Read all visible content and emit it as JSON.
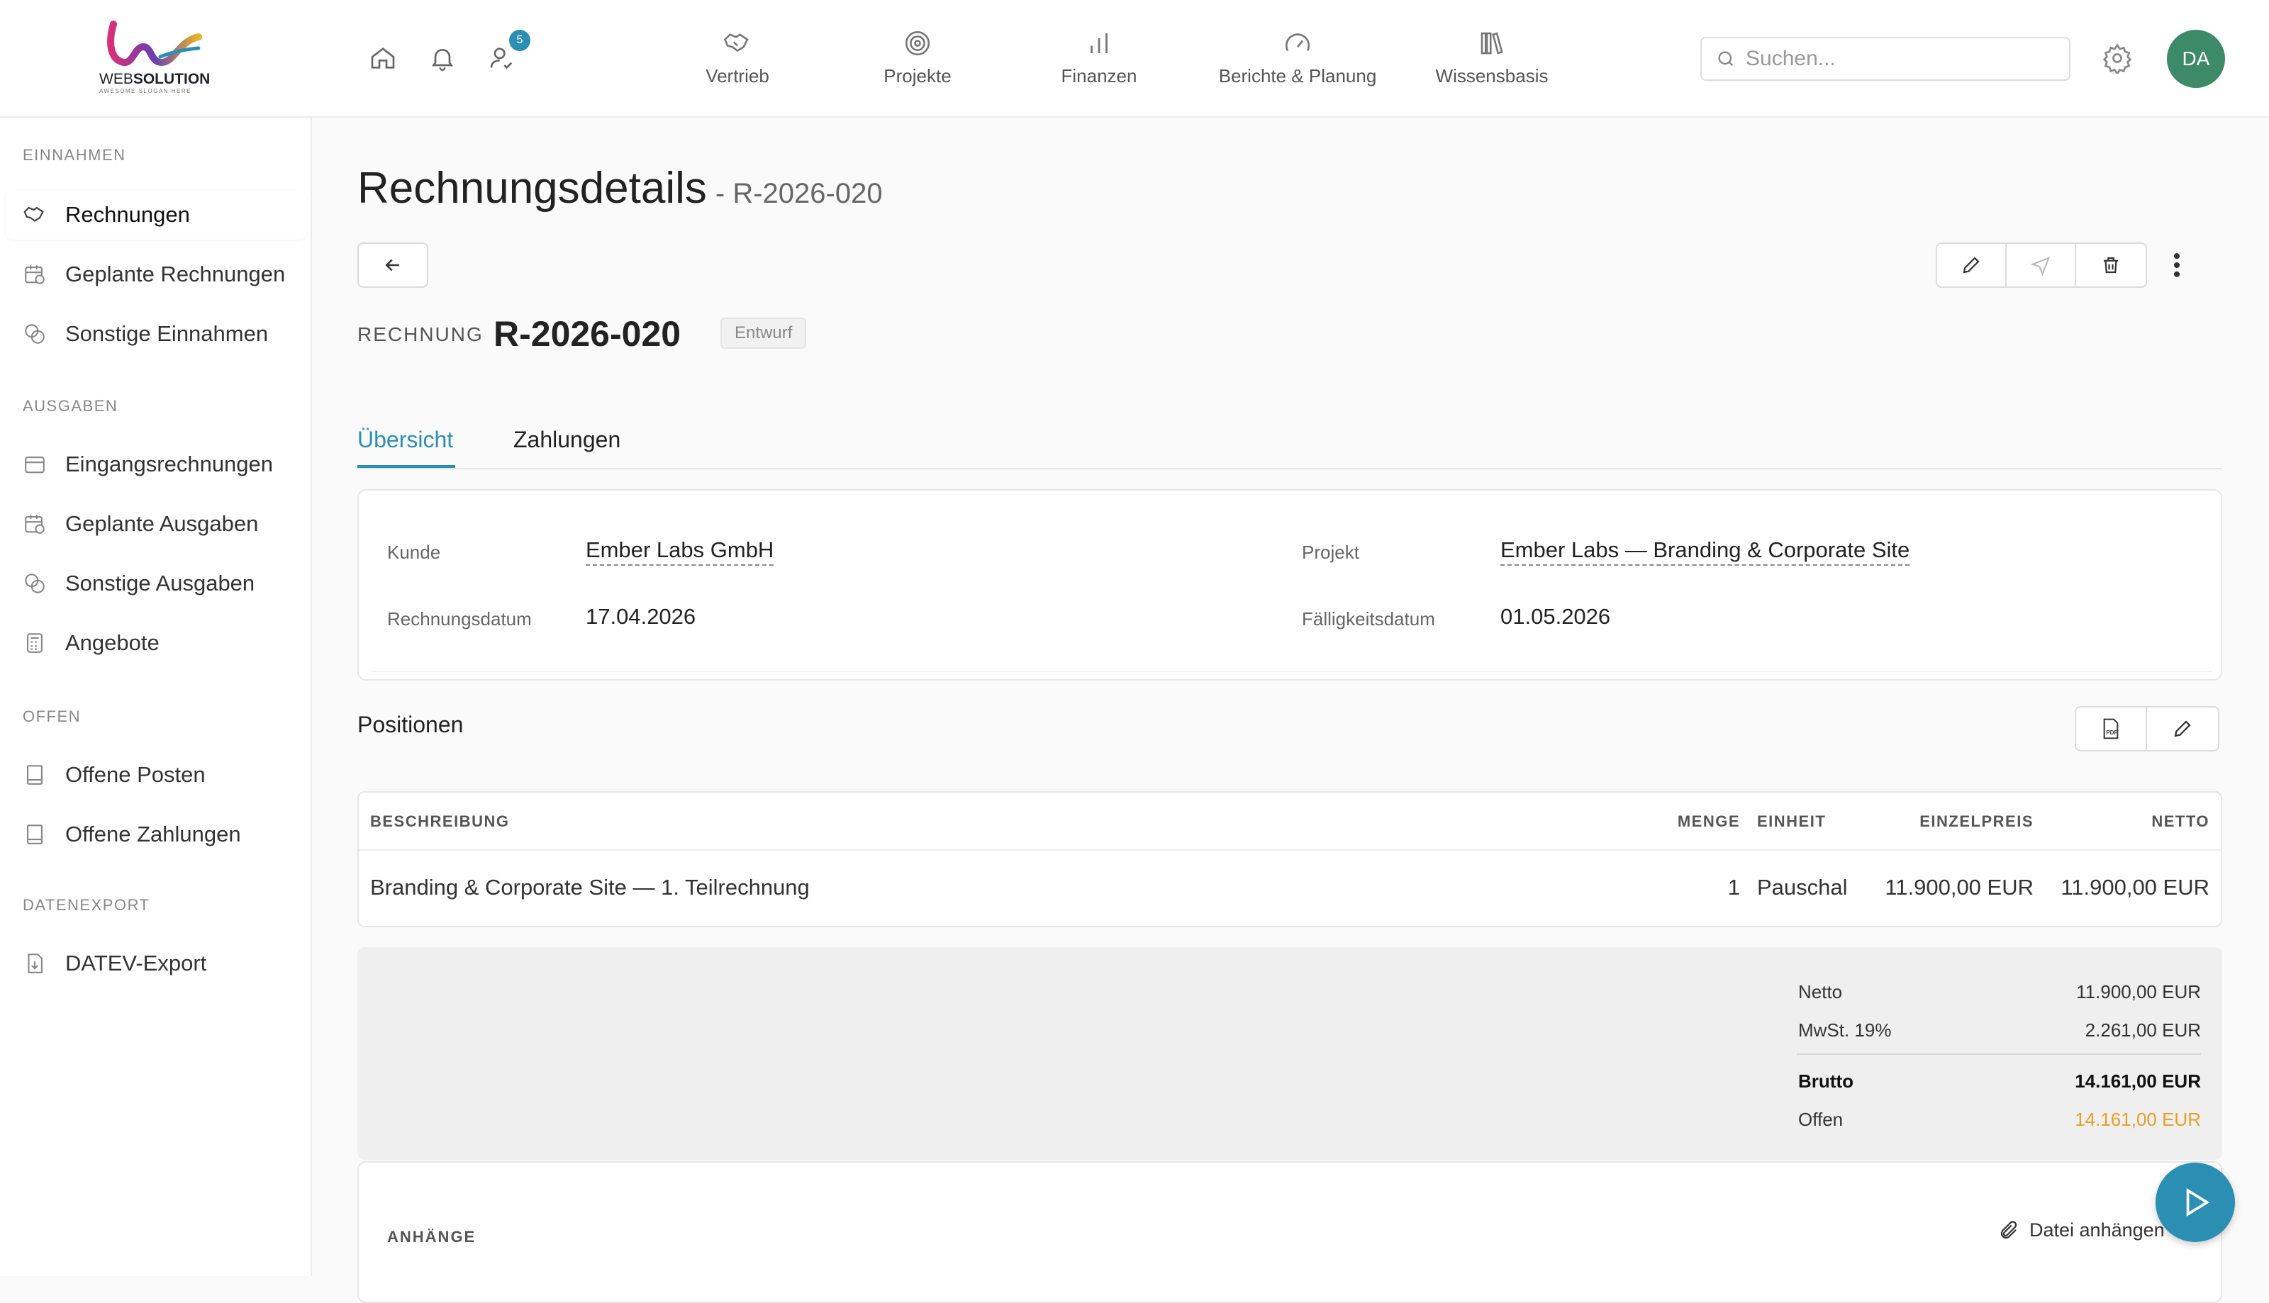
{
  "brand": {
    "name_a": "WEB",
    "name_b": "SOLUTION",
    "tagline": "AWESOME SLOGAN HERE"
  },
  "header": {
    "notification_badge": "5",
    "nav": [
      {
        "label": "Vertrieb",
        "icon": "handshake-icon"
      },
      {
        "label": "Projekte",
        "icon": "target-icon"
      },
      {
        "label": "Finanzen",
        "icon": "bar-chart-icon"
      },
      {
        "label": "Berichte & Planung",
        "icon": "gauge-icon"
      },
      {
        "label": "Wissensbasis",
        "icon": "books-icon"
      }
    ],
    "search_placeholder": "Suchen...",
    "avatar_initials": "DA"
  },
  "sidebar": {
    "sections": [
      {
        "title": "EINNAHMEN",
        "items": [
          {
            "label": "Rechnungen",
            "active": true
          },
          {
            "label": "Geplante Rechnungen"
          },
          {
            "label": "Sonstige Einnahmen"
          }
        ]
      },
      {
        "title": "AUSGABEN",
        "items": [
          {
            "label": "Eingangsrechnungen"
          },
          {
            "label": "Geplante Ausgaben"
          },
          {
            "label": "Sonstige Ausgaben"
          },
          {
            "label": "Angebote"
          }
        ]
      },
      {
        "title": "OFFEN",
        "items": [
          {
            "label": "Offene Posten"
          },
          {
            "label": "Offene Zahlungen"
          }
        ]
      },
      {
        "title": "DATENEXPORT",
        "items": [
          {
            "label": "DATEV-Export"
          }
        ]
      }
    ]
  },
  "page": {
    "title": "Rechnungsdetails",
    "subtitle": "- R-2026-020",
    "invoice_label": "RECHNUNG",
    "invoice_number": "R-2026-020",
    "status": "Entwurf",
    "tabs": [
      "Übersicht",
      "Zahlungen"
    ],
    "details": {
      "kunde_label": "Kunde",
      "kunde": "Ember Labs GmbH",
      "projekt_label": "Projekt",
      "projekt": "Ember Labs — Branding & Corporate Site",
      "datum_label": "Rechnungsdatum",
      "datum": "17.04.2026",
      "faellig_label": "Fälligkeitsdatum",
      "faellig": "01.05.2026"
    },
    "positions_title": "Positionen",
    "table": {
      "headers": [
        "BESCHREIBUNG",
        "MENGE",
        "EINHEIT",
        "EINZELPREIS",
        "NETTO"
      ],
      "rows": [
        [
          "Branding & Corporate Site — 1. Teilrechnung",
          "1",
          "Pauschal",
          "11.900,00 EUR",
          "11.900,00 EUR"
        ]
      ]
    },
    "totals": {
      "netto_label": "Netto",
      "netto": "11.900,00 EUR",
      "mwst_label": "MwSt. 19%",
      "mwst": "2.261,00 EUR",
      "brutto_label": "Brutto",
      "brutto": "14.161,00 EUR",
      "offen_label": "Offen",
      "offen": "14.161,00 EUR"
    },
    "attachments_title": "ANHÄNGE",
    "attach_button": "Datei anhängen"
  },
  "colors": {
    "accent": "#2b8fb3",
    "open_amount": "#e8a024",
    "avatar": "#3d8a68"
  }
}
